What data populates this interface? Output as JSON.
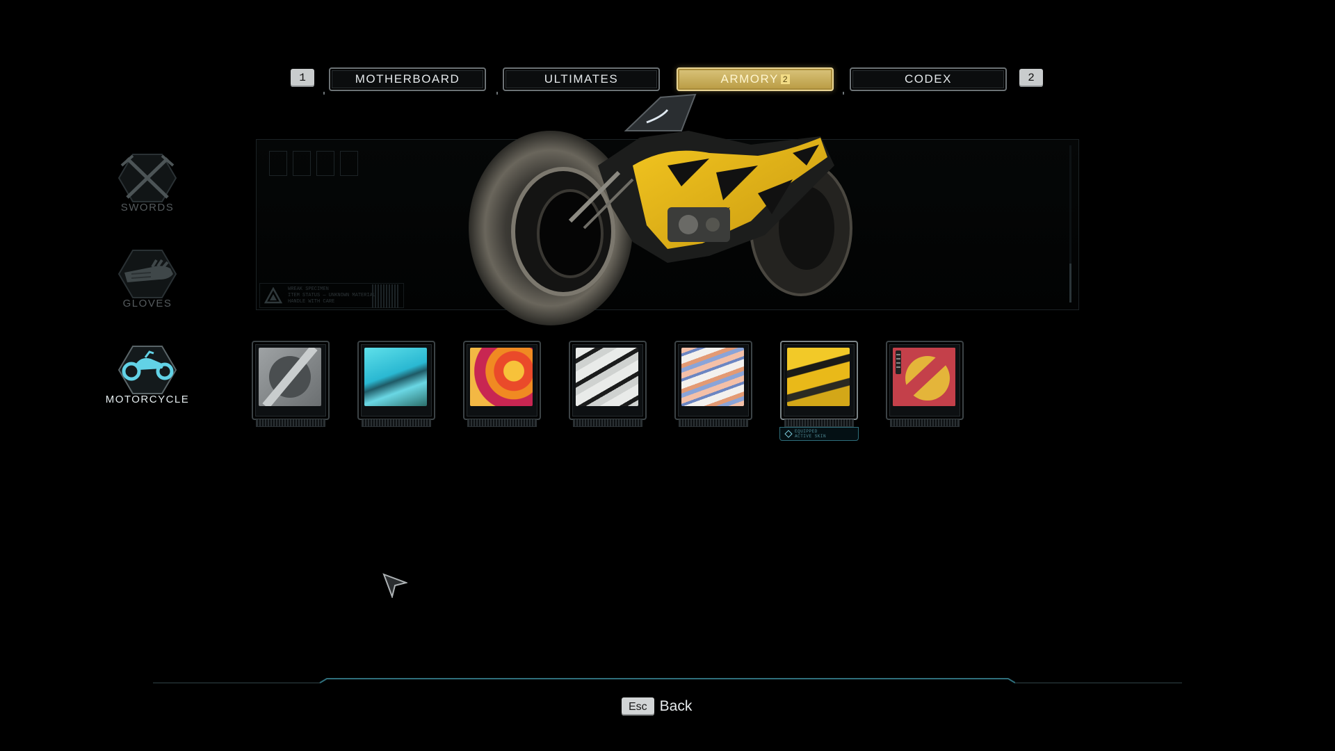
{
  "tabs": {
    "left_key": "1",
    "right_key": "2",
    "items": [
      {
        "label": "MOTHERBOARD"
      },
      {
        "label": "ULTIMATES"
      },
      {
        "label": "ARMORY",
        "badge": "2",
        "active": true
      },
      {
        "label": "CODEX"
      }
    ]
  },
  "categories": [
    {
      "label": "SWORDS",
      "icon": "crossed-swords-icon"
    },
    {
      "label": "GLOVES",
      "icon": "glove-icon"
    },
    {
      "label": "MOTORCYCLE",
      "icon": "motorcycle-icon",
      "active": true
    }
  ],
  "preview": {
    "warning_lines": [
      "WREAK SPECIMEN",
      "ITEM STATUS — UNKNOWN MATERIAL",
      "HANDLE WITH CARE"
    ]
  },
  "skins": [
    {
      "name": "none-skin",
      "selected": false
    },
    {
      "name": "cyan-skin",
      "selected": false
    },
    {
      "name": "red-yellow-skin",
      "selected": false
    },
    {
      "name": "white-black-skin",
      "selected": false
    },
    {
      "name": "pastel-swirl-skin",
      "selected": false
    },
    {
      "name": "yellow-black-skin",
      "selected": true
    },
    {
      "name": "red-yellow-diagonal-skin",
      "selected": false
    }
  ],
  "equipped": {
    "lines": [
      "EQUIPPED",
      "ACTIVE SKIN"
    ]
  },
  "footer": {
    "key": "Esc",
    "label": "Back"
  },
  "colors": {
    "accent_gold": "#d9c37a",
    "accent_cyan": "#5fd4e8",
    "panel_border": "#3c4346"
  }
}
